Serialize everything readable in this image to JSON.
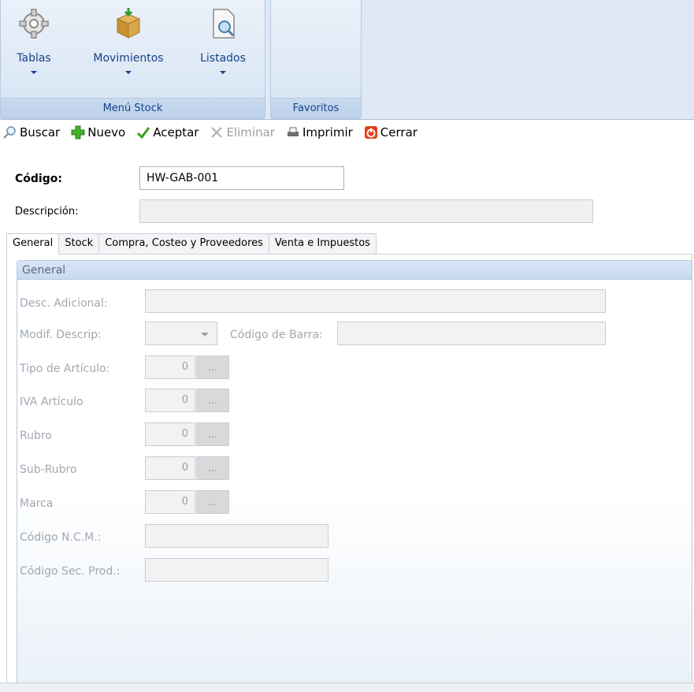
{
  "ribbon": {
    "groups": [
      {
        "caption": "Menú Stock",
        "buttons": [
          {
            "label": "Tablas",
            "icon": "gear-icon"
          },
          {
            "label": "Movimientos",
            "icon": "box-icon"
          },
          {
            "label": "Listados",
            "icon": "document-search-icon"
          }
        ]
      },
      {
        "caption": "Favoritos",
        "buttons": []
      }
    ]
  },
  "toolbar": {
    "buscar": "Buscar",
    "nuevo": "Nuevo",
    "aceptar": "Aceptar",
    "eliminar": "Eliminar",
    "imprimir": "Imprimir",
    "cerrar": "Cerrar"
  },
  "header": {
    "codigo_label": "Código:",
    "codigo_value": "HW-GAB-001",
    "descripcion_label": "Descripción:",
    "descripcion_value": ""
  },
  "tabs": [
    "General",
    "Stock",
    "Compra, Costeo y Proveedores",
    "Venta e Impuestos"
  ],
  "general": {
    "group_title": "General",
    "desc_adicional": "Desc. Adicional:",
    "modif_descrip": "Modif. Descrip:",
    "codigo_barra": "Código de Barra:",
    "tipo_articulo": "Tipo de Artículo:",
    "iva_articulo": "IVA Artículo",
    "rubro": "Rubro",
    "sub_rubro": "Sub-Rubro",
    "marca": "Marca",
    "codigo_ncm": "Código N.C.M.:",
    "codigo_sec_prod": "Código Sec. Prod.:",
    "tipo_articulo_value": "0",
    "iva_articulo_value": "0",
    "rubro_value": "0",
    "sub_rubro_value": "0",
    "marca_value": "0",
    "lookup_button": "..."
  },
  "colors": {
    "ribbon_text": "#15428b",
    "disabled_text": "#a3a8ae",
    "group_header": "#c8daf0"
  }
}
